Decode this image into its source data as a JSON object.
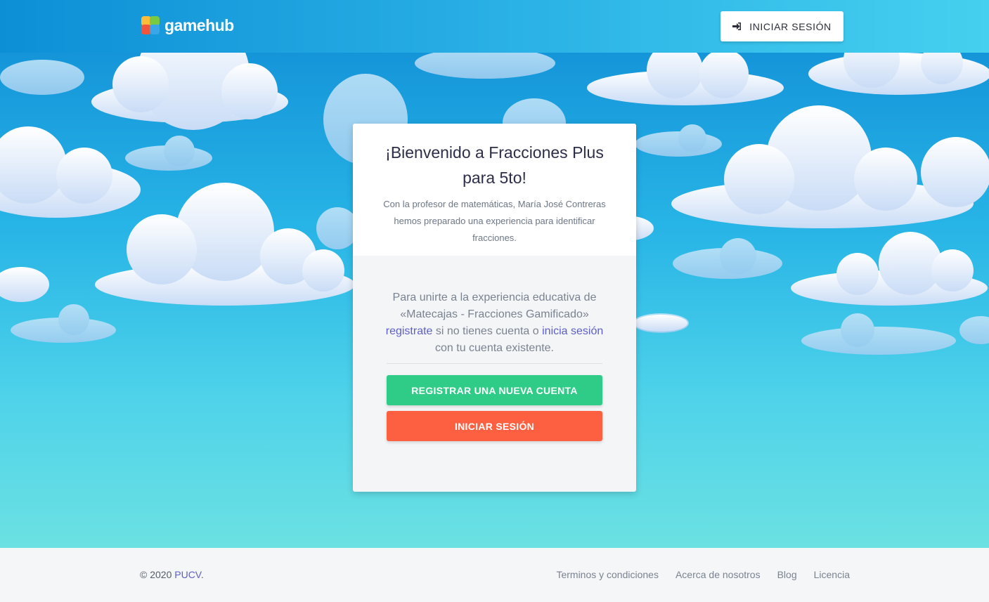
{
  "brand": {
    "name": "gamehub"
  },
  "header": {
    "login_label": "INICIAR SESIÓN",
    "login_icon": "sign-in-icon"
  },
  "card": {
    "title": "¡Bienvenido a Fracciones Plus para 5to!",
    "subtitle": "Con la profesor de matemáticas, María José Contreras hemos preparado una experiencia para identificar fracciones.",
    "text_before": "Para unirte a la experiencia educativa de «Matecajas - Fracciones Gamificado»",
    "register_link": "registrate",
    "text_middle": "si no tienes cuenta o",
    "login_link": "inicia sesión",
    "text_after": "con tu cuenta existente.",
    "register_button": "REGISTRAR UNA NUEVA CUENTA",
    "login_button": "INICIAR SESIÓN"
  },
  "footer": {
    "copyright": "© 2020",
    "org_link": "PUCV",
    "period": ".",
    "links": [
      "Terminos y condiciones",
      "Acerca de nosotros",
      "Blog",
      "Licencia"
    ]
  },
  "colors": {
    "green": "#2ecc87",
    "orange": "#fd6040",
    "link": "#5d5fc9"
  }
}
